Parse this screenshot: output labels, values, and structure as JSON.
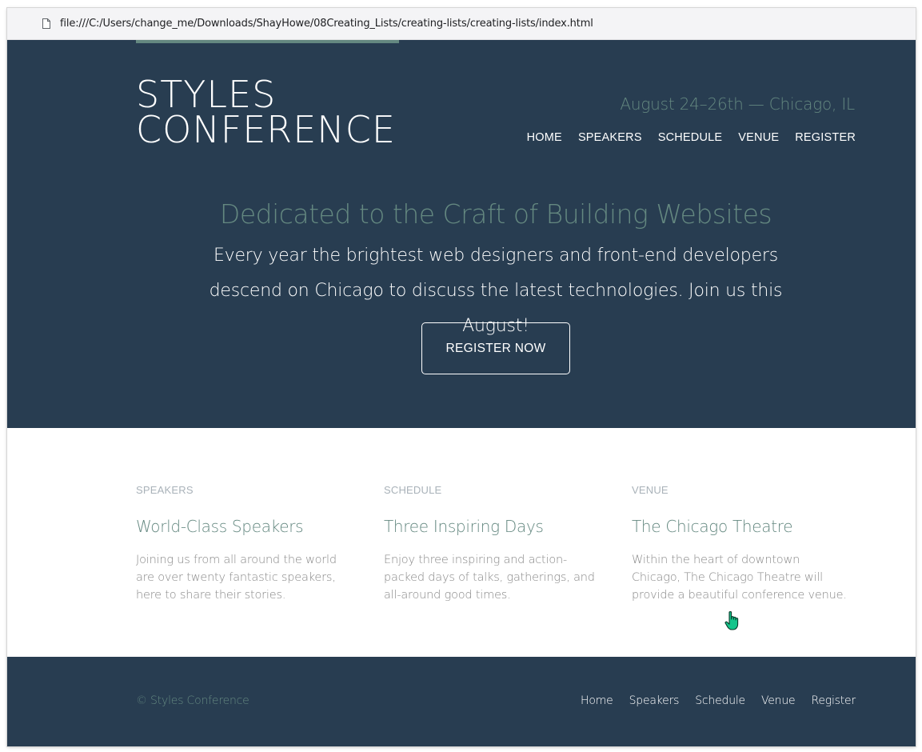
{
  "browser": {
    "url": "file:///C:/Users/change_me/Downloads/ShayHowe/08Creating_Lists/creating-lists/creating-lists/index.html",
    "page_icon": "page-icon"
  },
  "header": {
    "logo_line1": "STYLES",
    "logo_line2": "CONFERENCE",
    "tagline": "August 24–26th — Chicago, IL",
    "nav": [
      "HOME",
      "SPEAKERS",
      "SCHEDULE",
      "VENUE",
      "REGISTER"
    ]
  },
  "hero": {
    "title": "Dedicated to the Craft of Building Websites",
    "text": "Every year the brightest web designers and front-end developers descend on Chicago to discuss the latest technologies. Join us this August!",
    "button_label": "REGISTER NOW"
  },
  "features": [
    {
      "kicker": "SPEAKERS",
      "heading": "World-Class Speakers",
      "text": "Joining us from all around the world are over twenty fantastic speakers, here to share their stories."
    },
    {
      "kicker": "SCHEDULE",
      "heading": "Three Inspiring Days",
      "text": "Enjoy three inspiring and action-packed days of talks, gatherings, and all-around good times."
    },
    {
      "kicker": "VENUE",
      "heading": "The Chicago Theatre",
      "text": "Within the heart of downtown Chicago, The Chicago Theatre will provide a beautiful conference venue."
    }
  ],
  "footer": {
    "copyright": "© Styles Conference",
    "nav": [
      "Home",
      "Speakers",
      "Schedule",
      "Venue",
      "Register"
    ]
  },
  "colors": {
    "navy": "#283d51",
    "accent": "#648880",
    "muted_text": "#888888",
    "kicker": "#a9b2b9",
    "cursor": "#14c58b"
  }
}
